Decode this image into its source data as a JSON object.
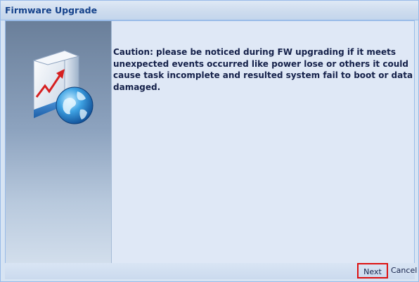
{
  "window": {
    "title": "Firmware Upgrade"
  },
  "side_panel": {
    "graphic_icon": "upgrade-box-globe-icon"
  },
  "main": {
    "caution_text": "Caution: please be noticed during FW upgrading if it meets unexpected events occurred like power lose or others it could cause task incomplete and resulted system fail to boot or data damaged."
  },
  "footer": {
    "next_label": "Next",
    "cancel_label": "Cancel"
  },
  "colors": {
    "title_text": "#15428b",
    "border": "#99bbe8",
    "highlight": "#dd1111"
  }
}
